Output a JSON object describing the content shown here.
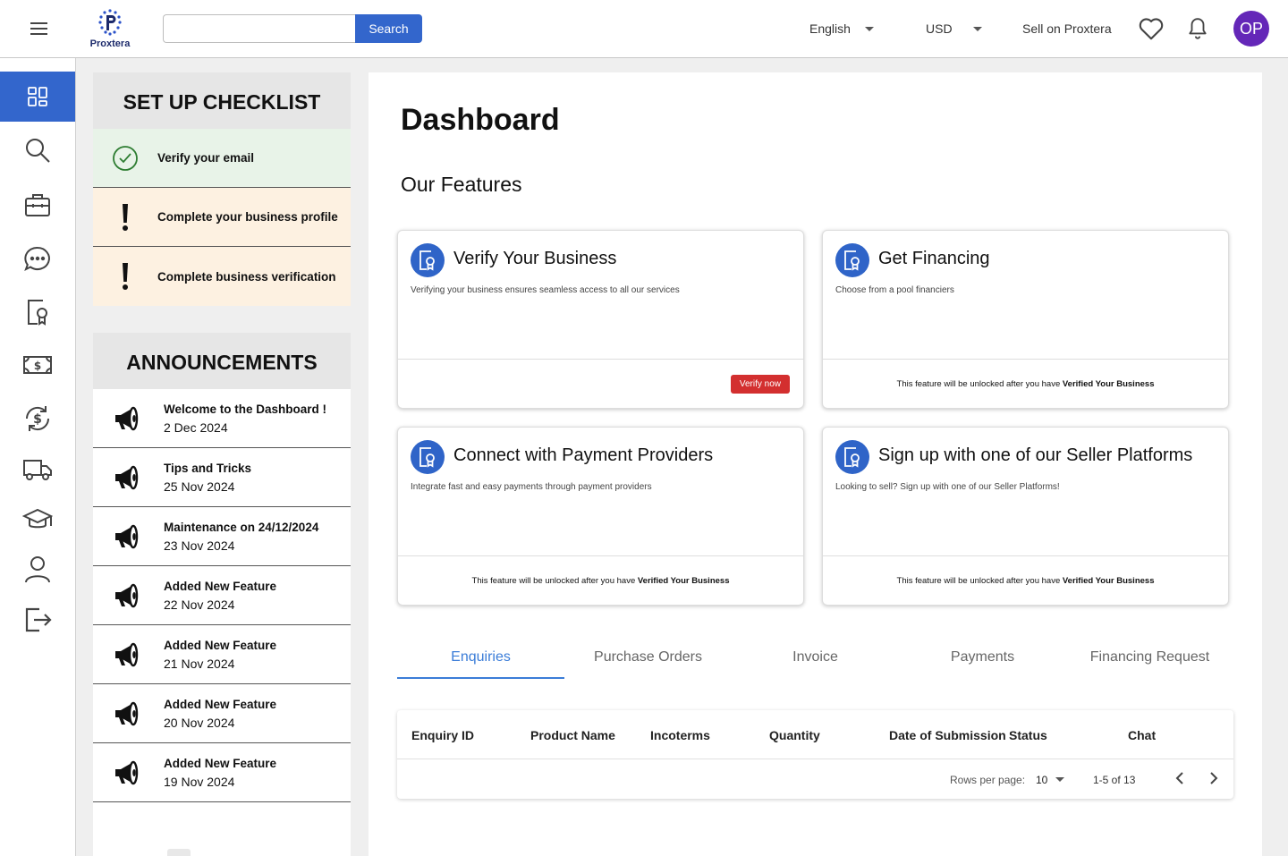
{
  "brand": {
    "name": "Proxtera"
  },
  "header": {
    "search_placeholder": "",
    "search_button": "Search",
    "language": "English",
    "currency": "USD",
    "sell_link": "Sell on Proxtera",
    "avatar_initials": "OP"
  },
  "sidebar": {
    "items": [
      {
        "icon": "dashboard-icon",
        "active": true
      },
      {
        "icon": "search-icon"
      },
      {
        "icon": "briefcase-icon"
      },
      {
        "icon": "chat-icon"
      },
      {
        "icon": "certificate-icon"
      },
      {
        "icon": "money-icon"
      },
      {
        "icon": "currency-exchange-icon"
      },
      {
        "icon": "truck-icon"
      },
      {
        "icon": "graduation-cap-icon"
      },
      {
        "icon": "person-icon"
      },
      {
        "icon": "logout-icon"
      }
    ]
  },
  "checklist": {
    "title": "SET UP CHECKLIST",
    "items": [
      {
        "label": "Verify your email",
        "status": "done"
      },
      {
        "label": "Complete your business profile",
        "status": "pending"
      },
      {
        "label": "Complete business verification",
        "status": "pending"
      }
    ]
  },
  "announcements": {
    "title": "ANNOUNCEMENTS",
    "items": [
      {
        "title": "Welcome to the Dashboard !",
        "date": "2 Dec 2024"
      },
      {
        "title": "Tips and Tricks",
        "date": "25 Nov 2024"
      },
      {
        "title": "Maintenance on 24/12/2024",
        "date": "23 Nov 2024"
      },
      {
        "title": "Added New Feature",
        "date": "22 Nov 2024"
      },
      {
        "title": "Added New Feature",
        "date": "21 Nov 2024"
      },
      {
        "title": "Added New Feature",
        "date": "20 Nov 2024"
      },
      {
        "title": "Added New Feature",
        "date": "19 Nov 2024"
      }
    ]
  },
  "main": {
    "title": "Dashboard",
    "features_title": "Our Features",
    "lock_prefix": "This feature will be unlocked after you have",
    "lock_emphasis": "Verified Your Business",
    "features": [
      {
        "title": "Verify Your Business",
        "description": "Verifying your business ensures seamless access to all our services",
        "action": "Verify now"
      },
      {
        "title": "Get Financing",
        "description": "Choose from a pool financiers"
      },
      {
        "title": "Connect with Payment Providers",
        "description": "Integrate fast and easy payments through payment providers"
      },
      {
        "title": "Sign up with one of our Seller Platforms",
        "description": "Looking to sell? Sign up with one of our Seller Platforms!"
      }
    ],
    "tabs": [
      "Enquiries",
      "Purchase Orders",
      "Invoice",
      "Payments",
      "Financing Request"
    ],
    "active_tab": "Enquiries",
    "table": {
      "columns": [
        "Enquiry ID",
        "Product Name",
        "Incoterms",
        "Quantity",
        "Date of Submission",
        "Status",
        "Chat"
      ],
      "rows": [],
      "rows_per_page_label": "Rows per page:",
      "rows_per_page": "10",
      "range": "1-5 of 13"
    }
  },
  "colors": {
    "accent": "#3366cc",
    "avatar": "#6427b8",
    "danger": "#d32f2f",
    "tab_active": "#3b7dd8",
    "done_bg": "#e8f3e8",
    "pending_bg": "#fdf1e1"
  }
}
